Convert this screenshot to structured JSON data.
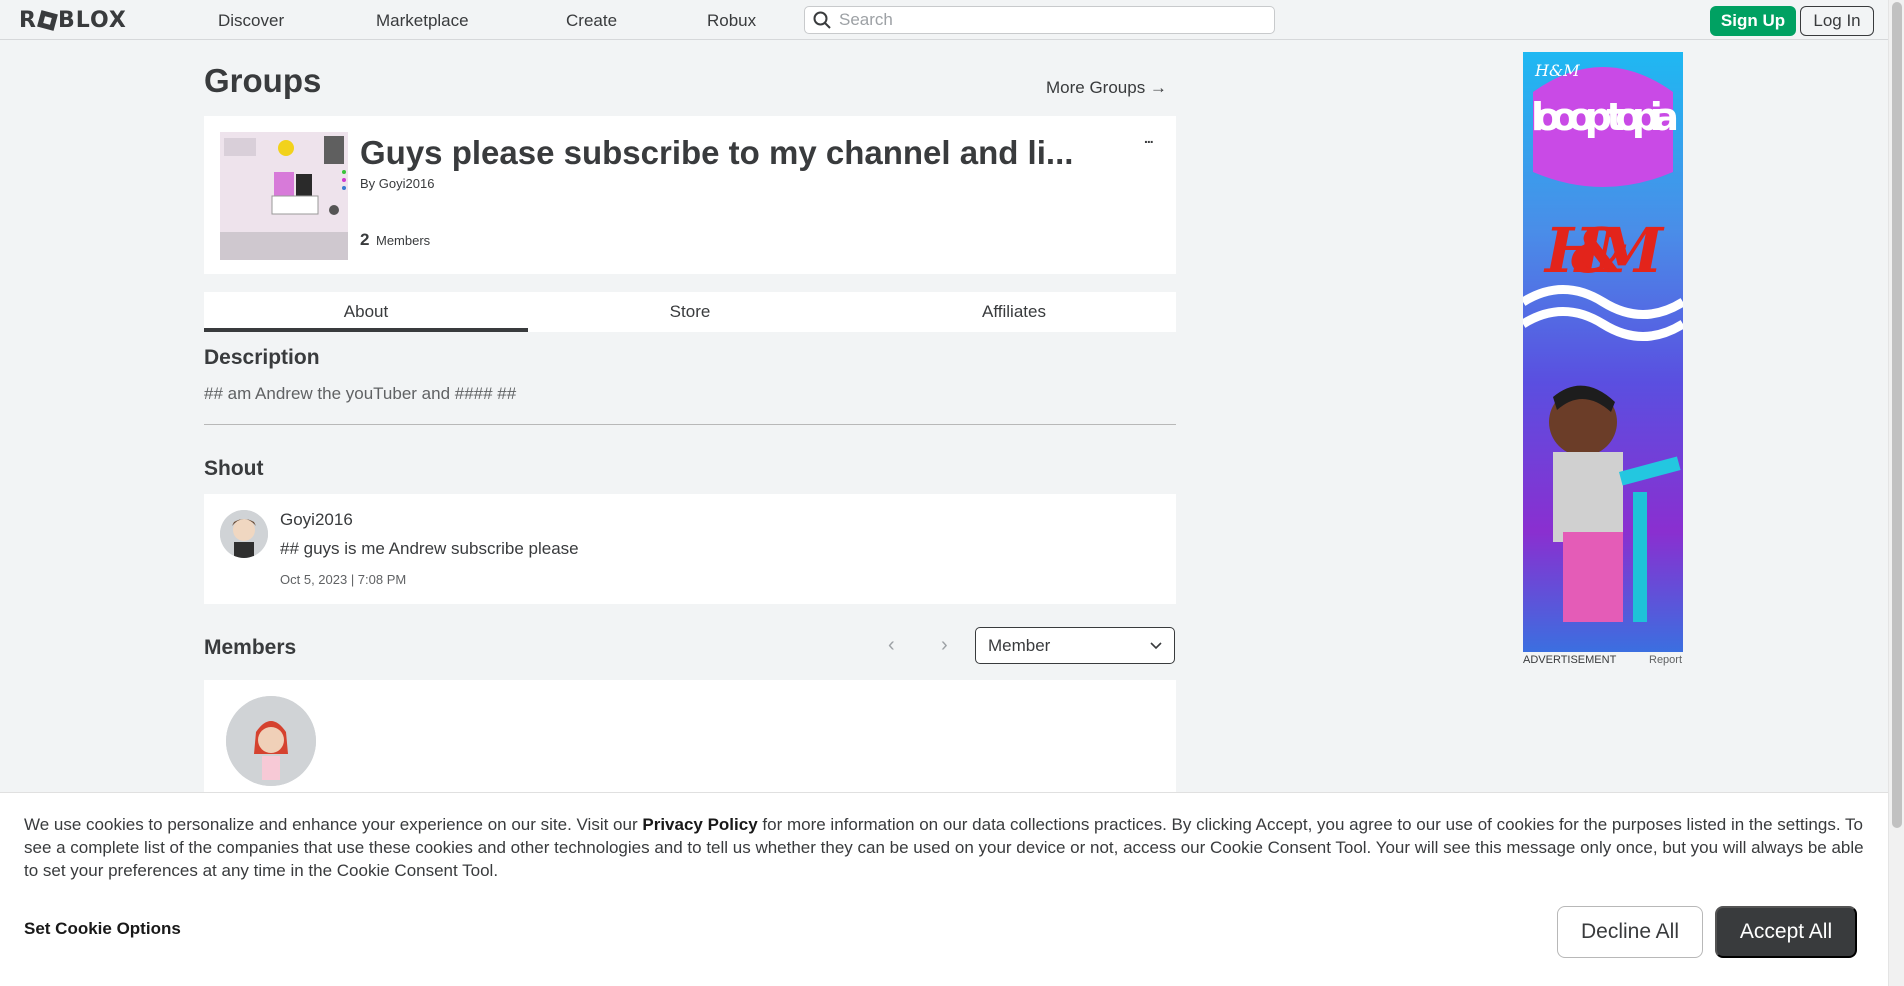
{
  "header": {
    "logo_text": "ROBLOX",
    "nav": [
      "Discover",
      "Marketplace",
      "Create",
      "Robux"
    ],
    "search_placeholder": "Search",
    "signup_label": "Sign Up",
    "login_label": "Log In"
  },
  "page": {
    "title": "Groups",
    "more_groups_label": "More Groups →"
  },
  "group": {
    "name": "Guys please subscribe to my channel and li...",
    "by_prefix": "By",
    "owner": "Goyi2016",
    "members_count": "2",
    "members_label": "Members",
    "more_menu": "..."
  },
  "tabs": [
    "About",
    "Store",
    "Affiliates"
  ],
  "description": {
    "heading": "Description",
    "text": "## am Andrew the youTuber and #### ##"
  },
  "shout": {
    "heading": "Shout",
    "user": "Goyi2016",
    "body": "## guys is me Andrew subscribe please",
    "date": "Oct 5, 2023 | 7:08 PM"
  },
  "members": {
    "heading": "Members",
    "role_selected": "Member",
    "prev_icon": "chevron-left-icon",
    "next_icon": "chevron-right-icon"
  },
  "ad": {
    "brand_small": "H&M",
    "headline": "looop topia",
    "brand_big": "H&M",
    "label": "ADVERTISEMENT",
    "report": "Report"
  },
  "cookie": {
    "text_before": "We use cookies to personalize and enhance your experience on our site. Visit our ",
    "privacy_link": "Privacy Policy",
    "text_after": " for more information on our data collections practices. By clicking Accept, you agree to our use of cookies for the purposes listed in the settings. To see a complete list of the companies that use these cookies and other technologies and to tell us whether they can be used on your device or not, access our Cookie Consent Tool. Your will see this message only once, but you will always be able to set your preferences at any time in the Cookie Consent Tool.",
    "options_label": "Set Cookie Options",
    "decline_label": "Decline All",
    "accept_label": "Accept All"
  },
  "colors": {
    "accent_green": "#00a162",
    "text_dark": "#393b3d",
    "background": "#f2f4f5"
  }
}
